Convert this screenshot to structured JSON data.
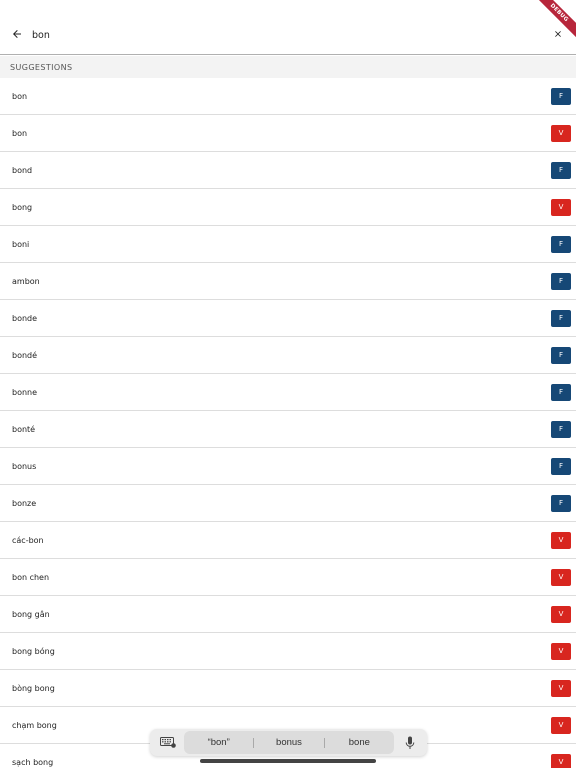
{
  "search": {
    "value": "bon",
    "placeholder": ""
  },
  "debug_banner": "DEBUG",
  "section_title": "SUGGESTIONS",
  "colors": {
    "tag_f": "#164876",
    "tag_v": "#d8261f"
  },
  "icons": {
    "back": "arrow-left-icon",
    "clear": "close-icon",
    "keyboard": "keyboard-icon",
    "mic": "microphone-icon"
  },
  "suggestions": [
    {
      "word": "bon",
      "tag": "F"
    },
    {
      "word": "bon",
      "tag": "V"
    },
    {
      "word": "bond",
      "tag": "F"
    },
    {
      "word": "bong",
      "tag": "V"
    },
    {
      "word": "boni",
      "tag": "F"
    },
    {
      "word": "ambon",
      "tag": "F"
    },
    {
      "word": "bonde",
      "tag": "F"
    },
    {
      "word": "bondé",
      "tag": "F"
    },
    {
      "word": "bonne",
      "tag": "F"
    },
    {
      "word": "bonté",
      "tag": "F"
    },
    {
      "word": "bonus",
      "tag": "F"
    },
    {
      "word": "bonze",
      "tag": "F"
    },
    {
      "word": "các-bon",
      "tag": "V"
    },
    {
      "word": "bon chen",
      "tag": "V"
    },
    {
      "word": "bong gân",
      "tag": "V"
    },
    {
      "word": "bong bóng",
      "tag": "V"
    },
    {
      "word": "bòng bong",
      "tag": "V"
    },
    {
      "word": "chạm bong",
      "tag": "V"
    },
    {
      "word": "sạch bong",
      "tag": "V"
    }
  ],
  "keyboard_suggestions": [
    "“bon”",
    "bonus",
    "bone"
  ]
}
